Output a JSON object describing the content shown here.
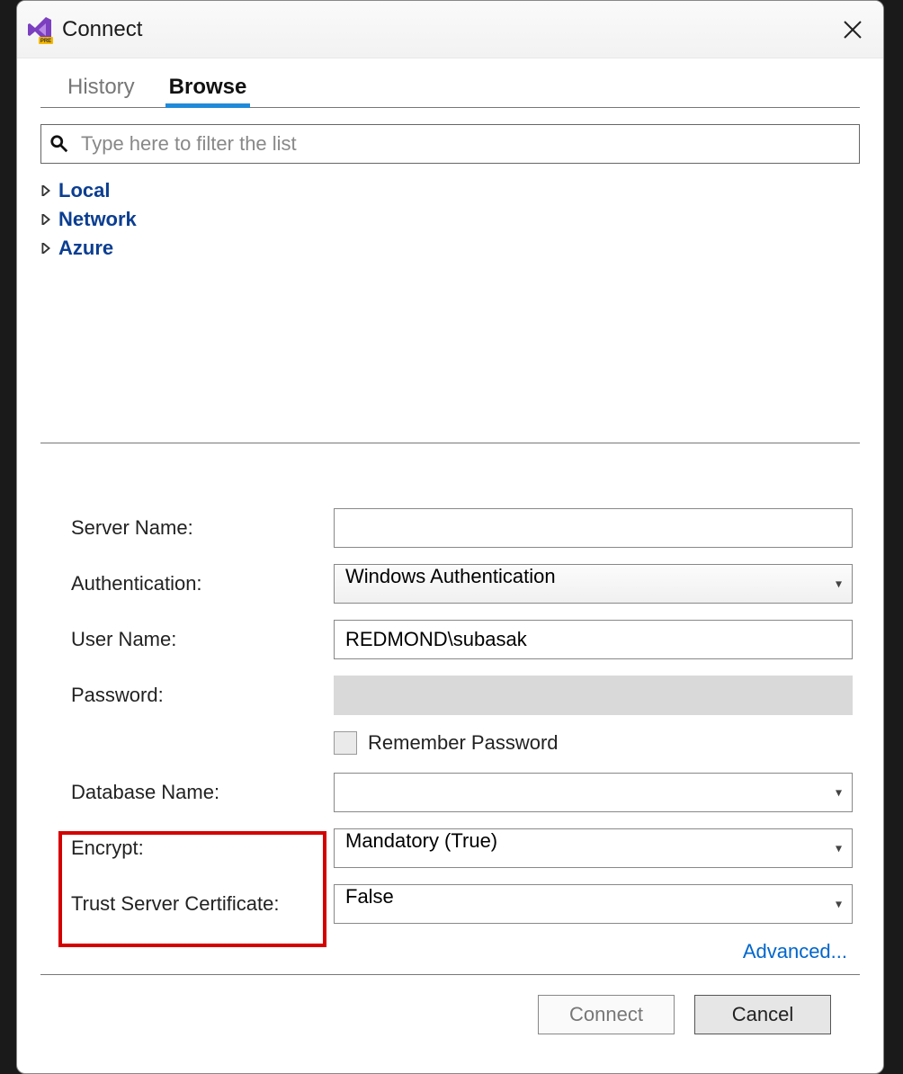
{
  "window": {
    "title": "Connect"
  },
  "tabs": [
    {
      "label": "History",
      "active": false
    },
    {
      "label": "Browse",
      "active": true
    }
  ],
  "filter": {
    "placeholder": "Type here to filter the list"
  },
  "tree": [
    {
      "label": "Local"
    },
    {
      "label": "Network"
    },
    {
      "label": "Azure"
    }
  ],
  "form": {
    "server_name_label": "Server Name:",
    "server_name_value": "",
    "authentication_label": "Authentication:",
    "authentication_value": "Windows Authentication",
    "user_name_label": "User Name:",
    "user_name_value": "REDMOND\\subasak",
    "password_label": "Password:",
    "password_value": "",
    "remember_password_label": "Remember Password",
    "database_name_label": "Database Name:",
    "database_name_value": "",
    "encrypt_label": "Encrypt:",
    "encrypt_value": "Mandatory (True)",
    "trust_cert_label": "Trust Server Certificate:",
    "trust_cert_value": "False",
    "advanced_label": "Advanced..."
  },
  "buttons": {
    "connect": "Connect",
    "cancel": "Cancel"
  }
}
